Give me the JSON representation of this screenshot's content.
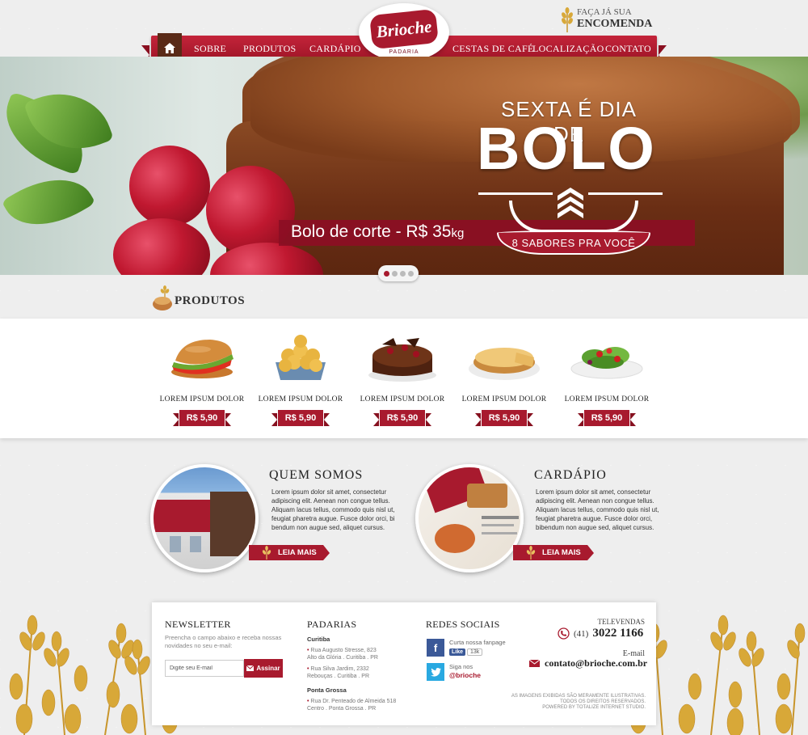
{
  "header": {
    "logo": {
      "brand": "Brioche",
      "sub": "PADARIA"
    },
    "encomenda": {
      "line1": "FAÇA JÁ SUA",
      "line2": "ENCOMENDA"
    },
    "nav_left": [
      "SOBRE",
      "PRODUTOS",
      "CARDÁPIO"
    ],
    "nav_right": [
      "CESTAS DE CAFÉ",
      "LOCALIZAÇÃO",
      "CONTATO"
    ]
  },
  "hero": {
    "line1": "SEXTA É DIA DE",
    "line2": "BOLO",
    "line3": "8 SABORES PRA VOCÊ",
    "price_text": "Bolo de corte - R$ 35",
    "price_unit": "kg",
    "slides": 4,
    "active_slide": 1
  },
  "produtos": {
    "title": "PRODUTOS",
    "items": [
      {
        "name": "LOREM IPSUM DOLOR",
        "price": "R$ 5,90",
        "icon": "sandwich-icon"
      },
      {
        "name": "LOREM IPSUM DOLOR",
        "price": "R$ 5,90",
        "icon": "cheese-bread-icon"
      },
      {
        "name": "LOREM IPSUM DOLOR",
        "price": "R$ 5,90",
        "icon": "chocolate-cake-icon"
      },
      {
        "name": "LOREM IPSUM DOLOR",
        "price": "R$ 5,90",
        "icon": "pie-icon"
      },
      {
        "name": "LOREM IPSUM DOLOR",
        "price": "R$ 5,90",
        "icon": "salad-icon"
      }
    ]
  },
  "quem_somos": {
    "title": "QUEM SOMOS",
    "text": "Lorem ipsum dolor sit amet, consectetur adipiscing elit. Aenean non congue tellus. Aliquam lacus tellus, commodo quis nisl ut, feugiat pharetra augue. Fusce dolor orci, bi bendum non augue sed, aliquet cursus.",
    "button": "LEIA MAIS"
  },
  "cardapio": {
    "title": "CARDÁPIO",
    "text": "Lorem ipsum dolor sit amet, consectetur adipiscing elit. Aenean non congue tellus. Aliquam lacus tellus, commodo quis nisl ut, feugiat pharetra augue. Fusce dolor orci, bibendum non augue sed, aliquet cursus.",
    "button": "LEIA MAIS"
  },
  "footer": {
    "newsletter": {
      "title": "NEWSLETTER",
      "text": "Preencha o campo abaixo e receba nossas novidades no seu e-mail:",
      "placeholder": "Digite seu E-mail",
      "button": "Assinar"
    },
    "padarias": {
      "title": "PADARIAS",
      "city1": "Curitiba",
      "addr1a_l1": "Rua Augusto Stresse, 823",
      "addr1a_l2": "Alto da Glória . Curitiba . PR",
      "addr1b_l1": "Rua Silva Jardim, 2332",
      "addr1b_l2": "Rebouças . Curitiba . PR",
      "city2": "Ponta Grossa",
      "addr2_l1": "Rua Dr. Penteado de Almeida 518",
      "addr2_l2": "Centro . Ponta Grossa . PR"
    },
    "social": {
      "title": "REDES SOCIAIS",
      "fb_text": "Curta nossa fanpage",
      "fb_like": "Like",
      "fb_count": "13k",
      "tw_text": "Siga nos",
      "tw_handle": "@brioche"
    },
    "contact": {
      "tele_label": "TELEVENDAS",
      "phone_prefix": "(41)",
      "phone": "3022 1166",
      "email_label": "E-mail",
      "email": "contato@brioche.com.br",
      "legal1": "AS IMAGENS EXIBIDAS SÃO MERAMENTE ILUSTRATIVAS.",
      "legal2": "TODOS OS DIREITOS RESERVADOS.",
      "legal3": "POWERED BY TOTALIZE INTERNET STUDIO."
    }
  },
  "colors": {
    "brand_red": "#a81a2e",
    "dark_red": "#86101f",
    "brown": "#5a2a17"
  }
}
